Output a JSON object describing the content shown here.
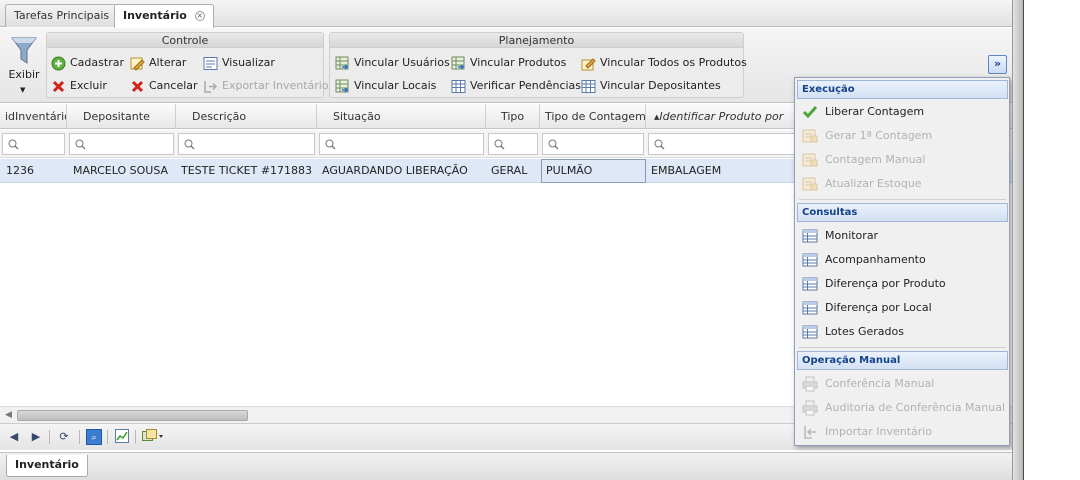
{
  "tabs": [
    {
      "label": "Tarefas Principais"
    },
    {
      "label": "Inventário",
      "close_icon": "close-circle-icon"
    }
  ],
  "toolbar": {
    "exibir_label": "Exibir",
    "controle": {
      "title": "Controle",
      "buttons": [
        {
          "label": "Cadastrar",
          "icon": "add-icon",
          "enabled": true
        },
        {
          "label": "Alterar",
          "icon": "edit-icon",
          "enabled": true
        },
        {
          "label": "Visualizar",
          "icon": "view-form-icon",
          "enabled": true
        },
        {
          "label": "Excluir",
          "icon": "delete-icon",
          "enabled": true
        },
        {
          "label": "Cancelar",
          "icon": "cancel-icon",
          "enabled": true
        },
        {
          "label": "Exportar Inventário",
          "icon": "export-icon",
          "enabled": false
        }
      ]
    },
    "planejamento": {
      "title": "Planejamento",
      "buttons": [
        {
          "label": "Vincular Usuários",
          "icon": "link-table-icon",
          "enabled": true
        },
        {
          "label": "Vincular Produtos",
          "icon": "link-table-icon",
          "enabled": true
        },
        {
          "label": "Vincular Todos os Produtos",
          "icon": "link-all-icon",
          "enabled": true
        },
        {
          "label": "Vincular Locais",
          "icon": "link-table-icon",
          "enabled": true
        },
        {
          "label": "Verificar Pendências",
          "icon": "grid-icon",
          "enabled": true
        },
        {
          "label": "Vincular Depositantes",
          "icon": "grid-icon",
          "enabled": true
        }
      ]
    },
    "overflow_label": "»"
  },
  "grid": {
    "columns": [
      "idInventário",
      "Depositante",
      "Descrição",
      "Situação",
      "Tipo",
      "Tipo de Contagem",
      "Identificar Produto por"
    ],
    "sorted_column_arrow": "▲",
    "rows": [
      [
        "1236",
        "MARCELO SOUSA",
        "TESTE TICKET #171883",
        "AGUARDANDO LIBERAÇÃO",
        "GERAL",
        "PULMÃO",
        "EMBALAGEM"
      ]
    ]
  },
  "bottom_tab": "Inventário",
  "menu": {
    "sections": [
      {
        "title": "Execução",
        "items": [
          {
            "label": "Liberar Contagem",
            "icon": "check-icon",
            "enabled": true
          },
          {
            "label": "Gerar 1ª Contagem",
            "icon": "form-icon",
            "enabled": false
          },
          {
            "label": "Contagem Manual",
            "icon": "form-icon",
            "enabled": false
          },
          {
            "label": "Atualizar Estoque",
            "icon": "form-icon",
            "enabled": false
          }
        ]
      },
      {
        "title": "Consultas",
        "items": [
          {
            "label": "Monitorar",
            "icon": "table-icon",
            "enabled": true
          },
          {
            "label": "Acompanhamento",
            "icon": "table-icon",
            "enabled": true
          },
          {
            "label": "Diferença por Produto",
            "icon": "table-icon",
            "enabled": true
          },
          {
            "label": "Diferença por Local",
            "icon": "table-icon",
            "enabled": true
          },
          {
            "label": "Lotes Gerados",
            "icon": "table-icon",
            "enabled": true
          }
        ]
      },
      {
        "title": "Operação Manual",
        "items": [
          {
            "label": "Conferência Manual",
            "icon": "printer-icon",
            "enabled": false
          },
          {
            "label": "Auditoria de Conferência Manual",
            "icon": "printer-icon",
            "enabled": false
          },
          {
            "label": "Importar Inventário",
            "icon": "import-icon",
            "enabled": false
          }
        ]
      }
    ]
  },
  "colors": {
    "selection_row": "#dfe8f6",
    "menu_header_text": "#15428b",
    "disabled_text": "#b2b2b2"
  }
}
